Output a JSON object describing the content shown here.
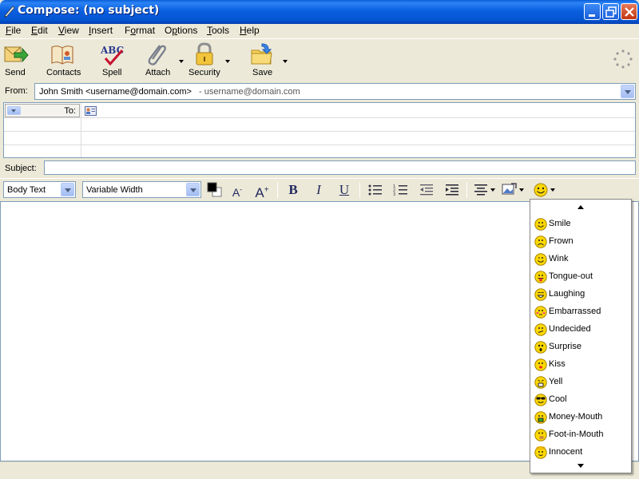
{
  "window": {
    "title": "Compose: (no subject)",
    "controls": [
      "minimize-icon",
      "restore-icon",
      "close-icon"
    ]
  },
  "menu": [
    {
      "label": "File",
      "underline": "F"
    },
    {
      "label": "Edit",
      "underline": "E"
    },
    {
      "label": "View",
      "underline": "V"
    },
    {
      "label": "Insert",
      "underline": "I"
    },
    {
      "label": "Format",
      "underline": "o"
    },
    {
      "label": "Options",
      "underline": "p"
    },
    {
      "label": "Tools",
      "underline": "T"
    },
    {
      "label": "Help",
      "underline": "H"
    }
  ],
  "toolbar": {
    "send": "Send",
    "contacts": "Contacts",
    "spell": "Spell",
    "attach": "Attach",
    "security": "Security",
    "save": "Save"
  },
  "header": {
    "from_label": "From:",
    "from_value": "John Smith <username@domain.com>",
    "from_account": "- username@domain.com",
    "to_label": "To:",
    "subject_label": "Subject:",
    "subject_value": ""
  },
  "format": {
    "paragraph_style": "Body Text",
    "font": "Variable Width",
    "text_color": "#000000"
  },
  "emoticons": [
    {
      "label": "Smile",
      "icon": "smile-icon"
    },
    {
      "label": "Frown",
      "icon": "frown-icon"
    },
    {
      "label": "Wink",
      "icon": "wink-icon"
    },
    {
      "label": "Tongue-out",
      "icon": "tongue-out-icon"
    },
    {
      "label": "Laughing",
      "icon": "laughing-icon"
    },
    {
      "label": "Embarrassed",
      "icon": "embarrassed-icon"
    },
    {
      "label": "Undecided",
      "icon": "undecided-icon"
    },
    {
      "label": "Surprise",
      "icon": "surprise-icon"
    },
    {
      "label": "Kiss",
      "icon": "kiss-icon"
    },
    {
      "label": "Yell",
      "icon": "yell-icon"
    },
    {
      "label": "Cool",
      "icon": "cool-icon"
    },
    {
      "label": "Money-Mouth",
      "icon": "money-mouth-icon"
    },
    {
      "label": "Foot-in-Mouth",
      "icon": "foot-in-mouth-icon"
    },
    {
      "label": "Innocent",
      "icon": "innocent-icon"
    }
  ],
  "colors": {
    "titlebar": "#0a5fe0",
    "chrome": "#ece9d8",
    "field_border": "#7f9db9",
    "emoticon_face": "#ffd800"
  }
}
